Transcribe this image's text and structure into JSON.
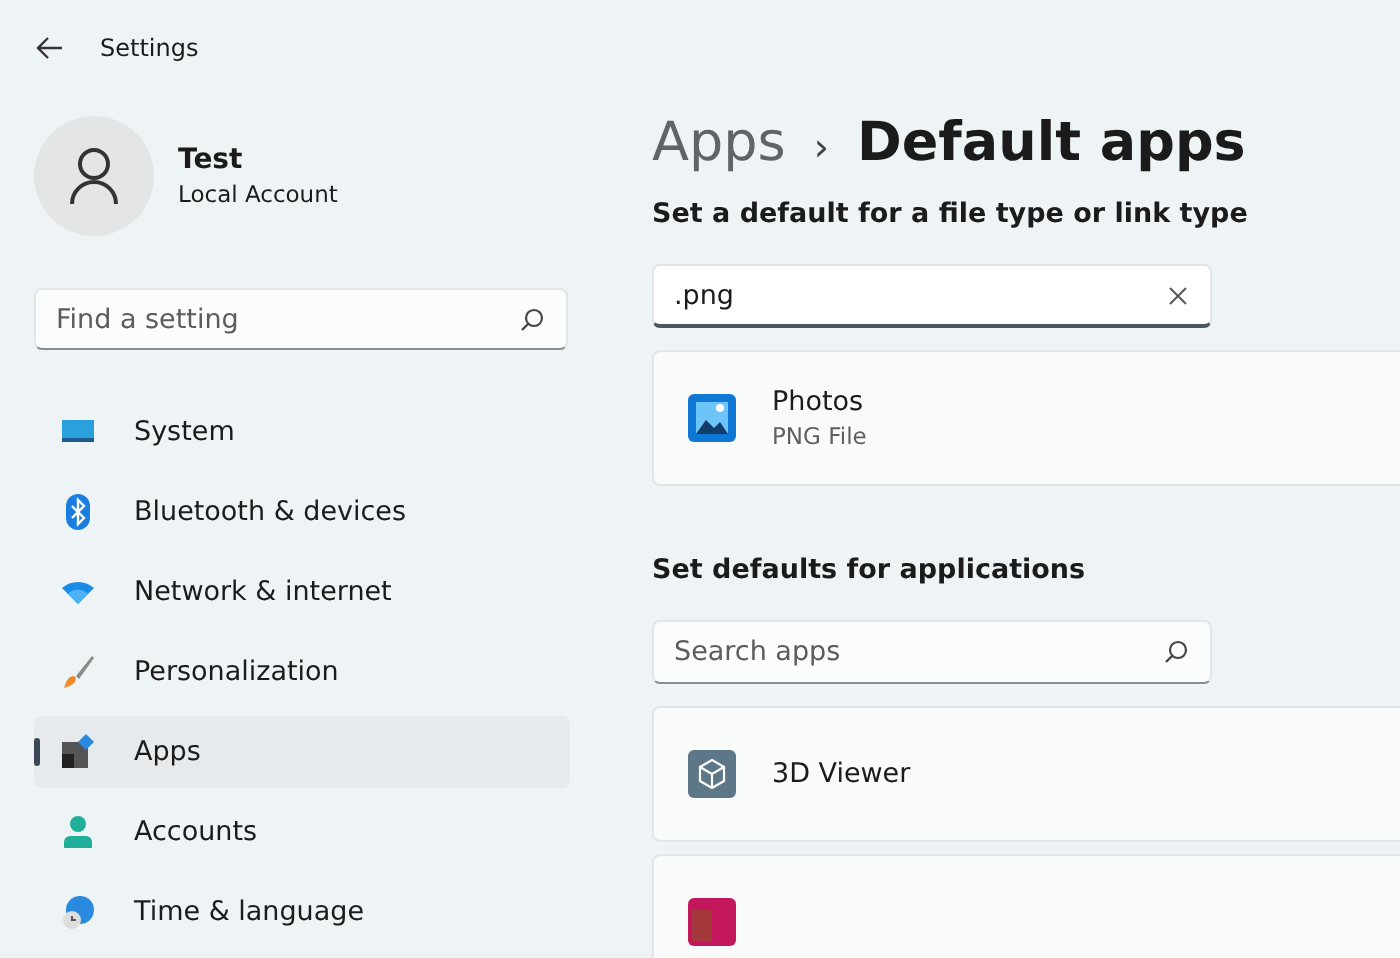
{
  "window": {
    "title": "Settings"
  },
  "account": {
    "name": "Test",
    "type": "Local Account"
  },
  "sidebar": {
    "search": {
      "placeholder": "Find a setting"
    },
    "items": [
      {
        "label": "System",
        "selected": false
      },
      {
        "label": "Bluetooth & devices",
        "selected": false
      },
      {
        "label": "Network & internet",
        "selected": false
      },
      {
        "label": "Personalization",
        "selected": false
      },
      {
        "label": "Apps",
        "selected": true
      },
      {
        "label": "Accounts",
        "selected": false
      },
      {
        "label": "Time & language",
        "selected": false
      }
    ]
  },
  "breadcrumb": {
    "parent": "Apps",
    "separator": "›",
    "current": "Default apps"
  },
  "file_type_section": {
    "heading": "Set a default for a file type or link type",
    "search": {
      "value": ".png"
    },
    "results": [
      {
        "app": "Photos",
        "file_type": "PNG File"
      }
    ]
  },
  "apps_section": {
    "heading": "Set defaults for applications",
    "search": {
      "placeholder": "Search apps"
    },
    "apps": [
      {
        "kind": "full",
        "name": "3D Viewer"
      },
      {
        "kind": "cut_off"
      }
    ]
  }
}
